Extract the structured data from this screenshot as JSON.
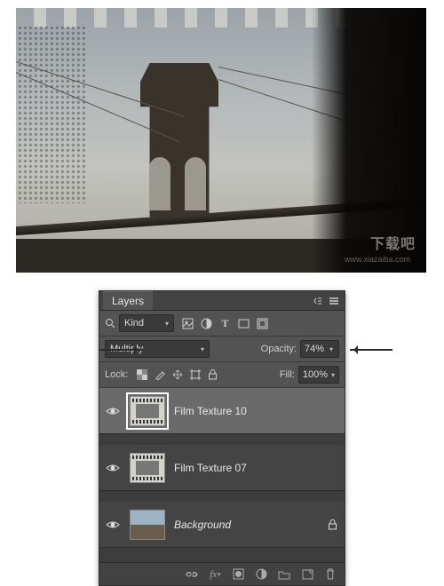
{
  "panel": {
    "title": "Layers",
    "filter": {
      "kind_label": "Kind"
    },
    "blend": {
      "mode": "Multiply",
      "opacity_label": "Opacity:",
      "opacity_value": "74%"
    },
    "lock": {
      "label": "Lock:",
      "fill_label": "Fill:",
      "fill_value": "100%"
    },
    "layers": [
      {
        "name": "Film Texture 10",
        "visible": true,
        "selected": true,
        "type": "film",
        "locked": false
      },
      {
        "name": "Film Texture 07",
        "visible": true,
        "selected": false,
        "type": "film",
        "locked": false
      },
      {
        "name": "Background",
        "visible": true,
        "selected": false,
        "type": "background",
        "locked": true,
        "italic": true
      }
    ],
    "icons": {
      "menu": "≡",
      "collapse": "«",
      "close": "×",
      "pixel": "▦",
      "adjust": "◐",
      "type": "T",
      "shape": "▭",
      "smart": "▣",
      "lock_transp": "▦",
      "brush": "✎",
      "move": "✥",
      "artboard": "⊞",
      "lock_all": "🔒",
      "eye": "👁",
      "link": "⧉",
      "fx": "fx",
      "mask": "◩",
      "adj": "◐",
      "group": "🗀",
      "new": "⊞",
      "trash": "🗑",
      "lock_small": "🔒"
    }
  },
  "watermark": {
    "main": "下载吧",
    "sub": "www.xiazaiba.com"
  }
}
